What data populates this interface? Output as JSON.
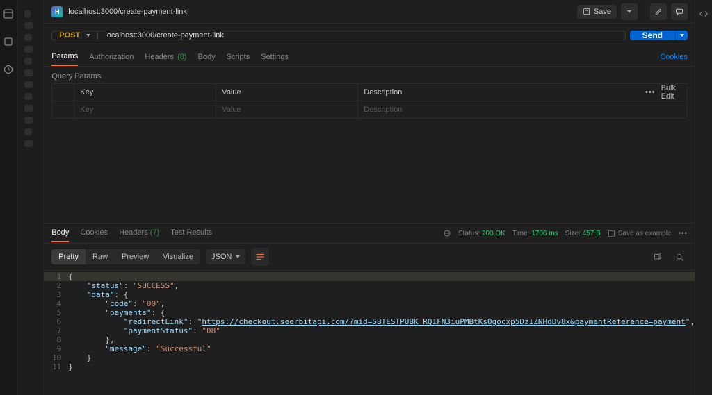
{
  "tab": {
    "title": "localhost:3000/create-payment-link"
  },
  "topbar": {
    "save": "Save"
  },
  "request": {
    "method": "POST",
    "url": "localhost:3000/create-payment-link",
    "send": "Send"
  },
  "req_tabs": {
    "params": "Params",
    "authorization": "Authorization",
    "headers": "Headers",
    "headers_count": "(8)",
    "body": "Body",
    "scripts": "Scripts",
    "settings": "Settings",
    "cookies": "Cookies"
  },
  "query_params": {
    "title": "Query Params",
    "key_header": "Key",
    "value_header": "Value",
    "description_header": "Description",
    "bulk_edit": "Bulk Edit",
    "key_placeholder": "Key",
    "value_placeholder": "Value",
    "description_placeholder": "Description"
  },
  "response": {
    "tabs": {
      "body": "Body",
      "cookies": "Cookies",
      "headers": "Headers",
      "headers_count": "(7)",
      "test": "Test Results"
    },
    "status_label": "Status:",
    "status_code": "200",
    "status_text": "OK",
    "time_label": "Time:",
    "time_value": "1706 ms",
    "size_label": "Size:",
    "size_value": "457 B",
    "save_example": "Save as example"
  },
  "viewer": {
    "modes": {
      "pretty": "Pretty",
      "raw": "Raw",
      "preview": "Preview",
      "visualize": "Visualize"
    },
    "lang": "JSON"
  },
  "json_body": {
    "status": "SUCCESS",
    "data": {
      "code": "00",
      "payments": {
        "redirectLink": "https://checkout.seerbitapi.com/?mid=SBTESTPUBK_RQ1FN3iuPMBtKs0gocxp5DzIZNHdDv8x&paymentReference=payment",
        "paymentStatus": "08"
      }
    },
    "message": "Successful"
  }
}
